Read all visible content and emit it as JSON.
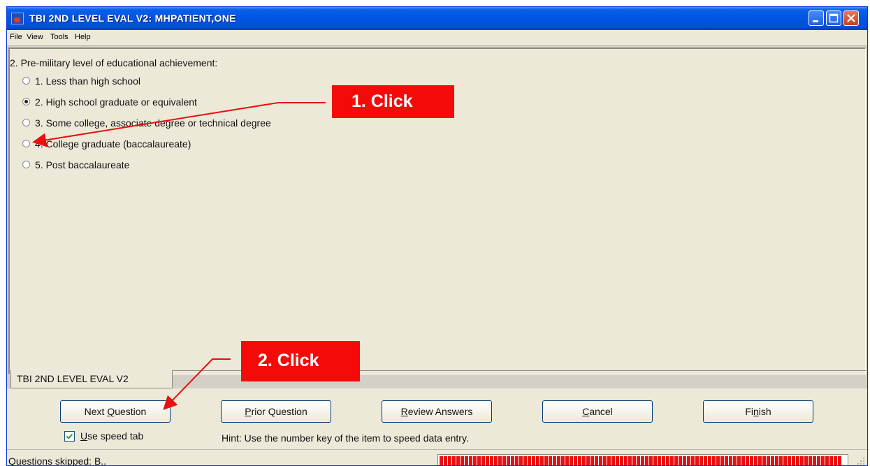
{
  "window": {
    "title": "TBI 2ND LEVEL EVAL V2: MHPATIENT,ONE",
    "controls": [
      "minimize",
      "maximize",
      "close"
    ]
  },
  "menu": [
    "File",
    "View",
    "Tools",
    "Help"
  ],
  "question": {
    "text": "2. Pre-military level of educational achievement:",
    "options": [
      {
        "label": "1. Less than high school",
        "selected": false
      },
      {
        "label": "2. High school graduate or equivalent",
        "selected": true
      },
      {
        "label": "3. Some college, associate degree or technical degree",
        "selected": false
      },
      {
        "label": "4. College graduate (baccalaureate)",
        "selected": false
      },
      {
        "label": "5. Post baccalaureate",
        "selected": false
      }
    ]
  },
  "callouts": {
    "step1": "1. Click",
    "step2": "2. Click"
  },
  "tab": {
    "label": "TBI 2ND LEVEL EVAL V2"
  },
  "buttons": {
    "next": {
      "pre": "Next ",
      "mnemonic": "Q",
      "post": "uestion"
    },
    "prior": {
      "pre": "",
      "mnemonic": "P",
      "post": "rior Question"
    },
    "review": {
      "pre": "",
      "mnemonic": "R",
      "post": "eview Answers"
    },
    "cancel": {
      "pre": "",
      "mnemonic": "C",
      "post": "ancel"
    },
    "finish": {
      "pre": "Fi",
      "mnemonic": "n",
      "post": "ish"
    }
  },
  "speed_tab": {
    "mnemonic": "U",
    "post": "se speed tab",
    "checked": true
  },
  "hint": "Hint: Use the number key of the item to speed data entry.",
  "status": {
    "text": "Questions skipped: B..",
    "progress_fraction": 0.99
  },
  "colors": {
    "callout": "#f50a0a",
    "titlebar": "#0054e3",
    "window": "#ece9d8"
  }
}
